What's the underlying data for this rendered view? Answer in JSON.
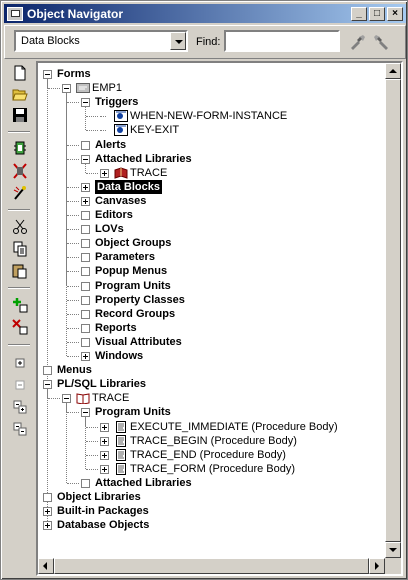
{
  "window": {
    "title": "Object Navigator",
    "controls": [
      "_",
      "□",
      "×"
    ]
  },
  "toolbar": {
    "view_select": {
      "value": "Data Blocks"
    },
    "find_label": "Find:",
    "find_value": ""
  },
  "side_tools": [
    "new-document-icon",
    "open-folder-icon",
    "save-icon",
    "run-debug-icon",
    "compile-icon",
    "run-icon",
    "cut-icon",
    "copy-icon",
    "paste-icon",
    "create-icon",
    "delete-icon",
    "expand-icon",
    "collapse-icon",
    "expand-all-icon",
    "collapse-all-icon"
  ],
  "tree": [
    {
      "label": "Forms",
      "level": 0,
      "bold": true,
      "state": "minus"
    },
    {
      "label": "EMP1",
      "level": 1,
      "bold": false,
      "state": "minus",
      "icon": "form-module-icon"
    },
    {
      "label": "Triggers",
      "level": 2,
      "bold": true,
      "state": "minus"
    },
    {
      "label": "WHEN-NEW-FORM-INSTANCE",
      "level": 3,
      "bold": false,
      "state": "leaf",
      "icon": "trigger-icon"
    },
    {
      "label": "KEY-EXIT",
      "level": 3,
      "bold": false,
      "state": "leaf",
      "icon": "trigger-icon"
    },
    {
      "label": "Alerts",
      "level": 2,
      "bold": true,
      "state": "empty"
    },
    {
      "label": "Attached Libraries",
      "level": 2,
      "bold": true,
      "state": "minus"
    },
    {
      "label": "TRACE",
      "level": 3,
      "bold": false,
      "state": "plus",
      "icon": "library-book-icon"
    },
    {
      "label": "Data Blocks",
      "level": 2,
      "bold": true,
      "state": "plus",
      "selected": true
    },
    {
      "label": "Canvases",
      "level": 2,
      "bold": true,
      "state": "plus"
    },
    {
      "label": "Editors",
      "level": 2,
      "bold": true,
      "state": "empty"
    },
    {
      "label": "LOVs",
      "level": 2,
      "bold": true,
      "state": "empty"
    },
    {
      "label": "Object Groups",
      "level": 2,
      "bold": true,
      "state": "empty"
    },
    {
      "label": "Parameters",
      "level": 2,
      "bold": true,
      "state": "empty"
    },
    {
      "label": "Popup Menus",
      "level": 2,
      "bold": true,
      "state": "empty"
    },
    {
      "label": "Program Units",
      "level": 2,
      "bold": true,
      "state": "empty"
    },
    {
      "label": "Property Classes",
      "level": 2,
      "bold": true,
      "state": "empty"
    },
    {
      "label": "Record Groups",
      "level": 2,
      "bold": true,
      "state": "empty"
    },
    {
      "label": "Reports",
      "level": 2,
      "bold": true,
      "state": "empty"
    },
    {
      "label": "Visual Attributes",
      "level": 2,
      "bold": true,
      "state": "empty"
    },
    {
      "label": "Windows",
      "level": 2,
      "bold": true,
      "state": "plus"
    },
    {
      "label": "Menus",
      "level": 0,
      "bold": true,
      "state": "empty"
    },
    {
      "label": "PL/SQL Libraries",
      "level": 0,
      "bold": true,
      "state": "minus"
    },
    {
      "label": "TRACE",
      "level": 1,
      "bold": false,
      "state": "minus",
      "icon": "open-book-icon"
    },
    {
      "label": "Program Units",
      "level": 2,
      "bold": true,
      "state": "minus"
    },
    {
      "label": "EXECUTE_IMMEDIATE (Procedure Body)",
      "level": 3,
      "bold": false,
      "state": "plus",
      "icon": "procedure-icon"
    },
    {
      "label": "TRACE_BEGIN (Procedure Body)",
      "level": 3,
      "bold": false,
      "state": "plus",
      "icon": "procedure-icon"
    },
    {
      "label": "TRACE_END (Procedure Body)",
      "level": 3,
      "bold": false,
      "state": "plus",
      "icon": "procedure-icon"
    },
    {
      "label": "TRACE_FORM (Procedure Body)",
      "level": 3,
      "bold": false,
      "state": "plus",
      "icon": "procedure-icon"
    },
    {
      "label": "Attached Libraries",
      "level": 2,
      "bold": true,
      "state": "empty"
    },
    {
      "label": "Object Libraries",
      "level": 0,
      "bold": true,
      "state": "empty"
    },
    {
      "label": "Built-in Packages",
      "level": 0,
      "bold": true,
      "state": "plus"
    },
    {
      "label": "Database Objects",
      "level": 0,
      "bold": true,
      "state": "plus"
    }
  ]
}
